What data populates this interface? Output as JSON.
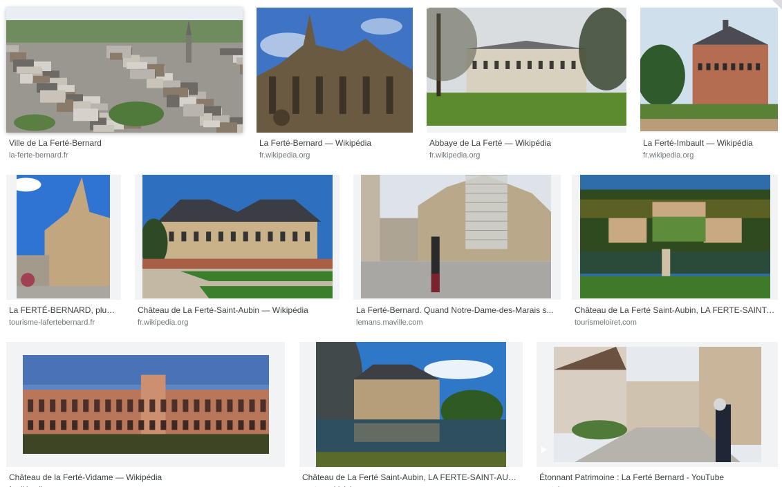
{
  "results": [
    {
      "title": "Ville de La Ferté-Bernard",
      "source": "la-ferte-bernard.fr",
      "scene": "aerial-town",
      "name": "result-ville-ferte-bernard"
    },
    {
      "title": "La Ferté-Bernard — Wikipédia",
      "source": "fr.wikipedia.org",
      "scene": "gothic-church-sky",
      "name": "result-ferte-bernard-wikipedia"
    },
    {
      "title": "Abbaye de La Ferté — Wikipédia",
      "source": "fr.wikipedia.org",
      "scene": "abbey-park",
      "name": "result-abbaye-ferte"
    },
    {
      "title": "La Ferté-Imbault — Wikipédia",
      "source": "fr.wikipedia.org",
      "scene": "brick-chateau",
      "name": "result-ferte-imbault"
    },
    {
      "title": "La FERTÉ-BERNARD, plus q...",
      "source": "tourisme-lafertebernard.fr",
      "scene": "church-street",
      "name": "result-tourisme-ferte-bernard"
    },
    {
      "title": "Château de La Ferté-Saint-Aubin — Wikipédia",
      "source": "fr.wikipedia.org",
      "scene": "chateau-lawn",
      "name": "result-chateau-saint-aubin-wikipedia"
    },
    {
      "title": "La Ferté-Bernard. Quand Notre-Dame-des-Marais s...",
      "source": "lemans.maville.com",
      "scene": "church-scaffold",
      "name": "result-notre-dame-des-marais"
    },
    {
      "title": "Château de La Ferté Saint-Aubin, LA FERTE-SAINT-...",
      "source": "tourismeloiret.com",
      "scene": "aerial-chateau",
      "name": "result-chateau-saint-aubin-loiret"
    },
    {
      "title": "Château de la Ferté-Vidame — Wikipédia",
      "source": "fr.wikipedia.org",
      "scene": "ruin-facade",
      "name": "result-ferte-vidame"
    },
    {
      "title": "Château de La Ferté Saint-Aubin, LA FERTE-SAINT-AUBI...",
      "source": "centre-valdeloire.org",
      "scene": "chateau-water",
      "name": "result-chateau-saint-aubin-water"
    },
    {
      "title": "Étonnant Patrimoine : La Ferté Bernard - YouTube",
      "source": "youtube.com",
      "scene": "old-street",
      "name": "result-youtube-patrimoine",
      "video": true
    }
  ],
  "colors": {
    "caption": "#3c4043",
    "source": "#70757a",
    "frame": "#f1f3f4"
  }
}
